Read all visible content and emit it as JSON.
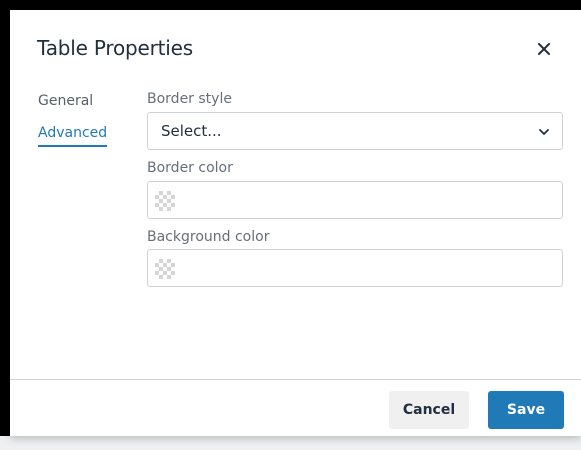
{
  "dialog": {
    "title": "Table Properties",
    "close_icon": "close-icon"
  },
  "tabs": [
    {
      "label": "General",
      "active": false
    },
    {
      "label": "Advanced",
      "active": true
    }
  ],
  "fields": {
    "border_style": {
      "label": "Border style",
      "selected": "Select...",
      "icon": "chevron-down-icon"
    },
    "border_color": {
      "label": "Border color",
      "value": ""
    },
    "background_color": {
      "label": "Background color",
      "value": ""
    }
  },
  "footer": {
    "cancel_label": "Cancel",
    "save_label": "Save"
  },
  "colors": {
    "accent": "#207ab7",
    "text": "#222f3e",
    "border": "#cfd3d7"
  }
}
